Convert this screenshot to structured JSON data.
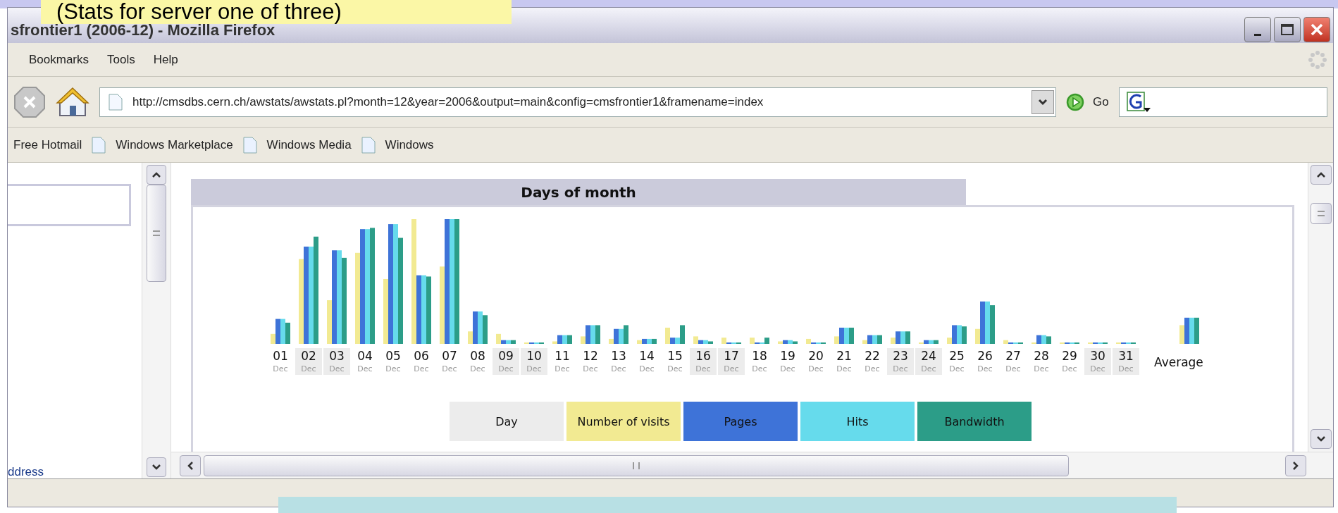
{
  "slide_label": "(Stats for server one of three)",
  "window": {
    "title": "sfrontier1 (2006-12) - Mozilla Firefox"
  },
  "menu": [
    "Bookmarks",
    "Tools",
    "Help"
  ],
  "address_bar": {
    "url": "http://cmsdbs.cern.ch/awstats/awstats.pl?month=12&year=2006&output=main&config=cmsfrontier1&framename=index",
    "go": "Go"
  },
  "bookmarks": [
    {
      "label": "Free Hotmail",
      "kind": "plain"
    },
    {
      "label": "Windows Marketplace",
      "kind": "page"
    },
    {
      "label": "Windows Media",
      "kind": "page"
    },
    {
      "label": "Windows",
      "kind": "page"
    }
  ],
  "left_frame": {
    "text": "ddress"
  },
  "chart": {
    "title": "Days of month",
    "average_label": "Average",
    "days": [
      {
        "day": "01",
        "month": "Dec",
        "weekend": false
      },
      {
        "day": "02",
        "month": "Dec",
        "weekend": true
      },
      {
        "day": "03",
        "month": "Dec",
        "weekend": true
      },
      {
        "day": "04",
        "month": "Dec",
        "weekend": false
      },
      {
        "day": "05",
        "month": "Dec",
        "weekend": false
      },
      {
        "day": "06",
        "month": "Dec",
        "weekend": false
      },
      {
        "day": "07",
        "month": "Dec",
        "weekend": false
      },
      {
        "day": "08",
        "month": "Dec",
        "weekend": false
      },
      {
        "day": "09",
        "month": "Dec",
        "weekend": true
      },
      {
        "day": "10",
        "month": "Dec",
        "weekend": true
      },
      {
        "day": "11",
        "month": "Dec",
        "weekend": false
      },
      {
        "day": "12",
        "month": "Dec",
        "weekend": false
      },
      {
        "day": "13",
        "month": "Dec",
        "weekend": false
      },
      {
        "day": "14",
        "month": "Dec",
        "weekend": false
      },
      {
        "day": "15",
        "month": "Dec",
        "weekend": false
      },
      {
        "day": "16",
        "month": "Dec",
        "weekend": true
      },
      {
        "day": "17",
        "month": "Dec",
        "weekend": true
      },
      {
        "day": "18",
        "month": "Dec",
        "weekend": false
      },
      {
        "day": "19",
        "month": "Dec",
        "weekend": false
      },
      {
        "day": "20",
        "month": "Dec",
        "weekend": false
      },
      {
        "day": "21",
        "month": "Dec",
        "weekend": false
      },
      {
        "day": "22",
        "month": "Dec",
        "weekend": false
      },
      {
        "day": "23",
        "month": "Dec",
        "weekend": true
      },
      {
        "day": "24",
        "month": "Dec",
        "weekend": true
      },
      {
        "day": "25",
        "month": "Dec",
        "weekend": false
      },
      {
        "day": "26",
        "month": "Dec",
        "weekend": false
      },
      {
        "day": "27",
        "month": "Dec",
        "weekend": false
      },
      {
        "day": "28",
        "month": "Dec",
        "weekend": false
      },
      {
        "day": "29",
        "month": "Dec",
        "weekend": false
      },
      {
        "day": "30",
        "month": "Dec",
        "weekend": true
      },
      {
        "day": "31",
        "month": "Dec",
        "weekend": true
      }
    ],
    "legend": [
      {
        "label": "Day",
        "color": "#ececec"
      },
      {
        "label": "Number of visits",
        "color": "#f2ea92"
      },
      {
        "label": "Pages",
        "color": "#3e73d8"
      },
      {
        "label": "Hits",
        "color": "#66dbec"
      },
      {
        "label": "Bandwidth",
        "color": "#2c9d88"
      }
    ]
  }
}
